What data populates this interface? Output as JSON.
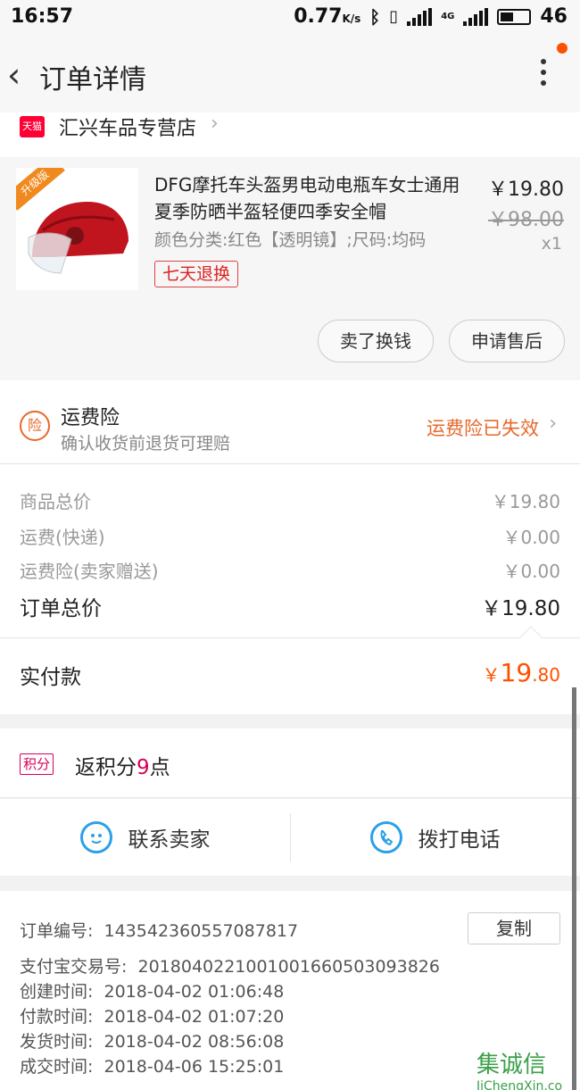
{
  "status_bar": {
    "time": "16:57",
    "speed": "0.77",
    "speed_unit": "K/s",
    "network": "4G",
    "battery": "46"
  },
  "header": {
    "title": "订单详情",
    "back_icon": "chevron-left-icon",
    "more_icon": "more-vertical-icon"
  },
  "shop": {
    "badge": "天猫",
    "name": "汇兴车品专营店"
  },
  "product": {
    "ribbon": "升级版",
    "title": "DFG摩托车头盔男电动电瓶车女士通用夏季防晒半盔轻便四季安全帽",
    "sku": "颜色分类:红色【透明镜】;尺码:均码",
    "return_badge": "七天退换",
    "price": "￥19.80",
    "original_price": "￥98.00",
    "quantity": "x1",
    "actions": [
      "卖了换钱",
      "申请售后"
    ]
  },
  "insurance": {
    "icon_text": "险",
    "title": "运费险",
    "subtitle": "确认收货前退货可理赔",
    "status": "运费险已失效"
  },
  "totals": {
    "rows": [
      {
        "label": "商品总价",
        "value": "￥19.80"
      },
      {
        "label": "运费(快递)",
        "value": "￥0.00"
      },
      {
        "label": "运费险(卖家赠送)",
        "value": "￥0.00"
      }
    ],
    "order_total_label": "订单总价",
    "order_total_value": "￥19.80"
  },
  "payment": {
    "label": "实付款",
    "currency": "￥",
    "integer": "19",
    "decimal": ".80"
  },
  "points": {
    "badge": "积分",
    "prefix": "返积分",
    "count": "9",
    "suffix": "点"
  },
  "contact": {
    "seller_label": "联系卖家",
    "phone_label": "拨打电话"
  },
  "order_info": {
    "copy_label": "复制",
    "rows": [
      {
        "key": "订单编号:",
        "value": "143542360557087817"
      },
      {
        "key": "支付宝交易号:",
        "value": "2018040221001001660503093826"
      },
      {
        "key": "创建时间:",
        "value": "2018-04-02 01:06:48"
      },
      {
        "key": "付款时间:",
        "value": "2018-04-02 01:07:20"
      },
      {
        "key": "发货时间:",
        "value": "2018-04-02 08:56:08"
      },
      {
        "key": "成交时间:",
        "value": "2018-04-06 15:25:01"
      }
    ]
  },
  "watermark": {
    "mark": "集",
    "chars": "诚信",
    "domain": "JiChengXin.co"
  },
  "colors": {
    "accent": "#ff5000",
    "tmall": "#ff0036",
    "points": "#d6005a",
    "link_blue": "#2ba0e8"
  }
}
